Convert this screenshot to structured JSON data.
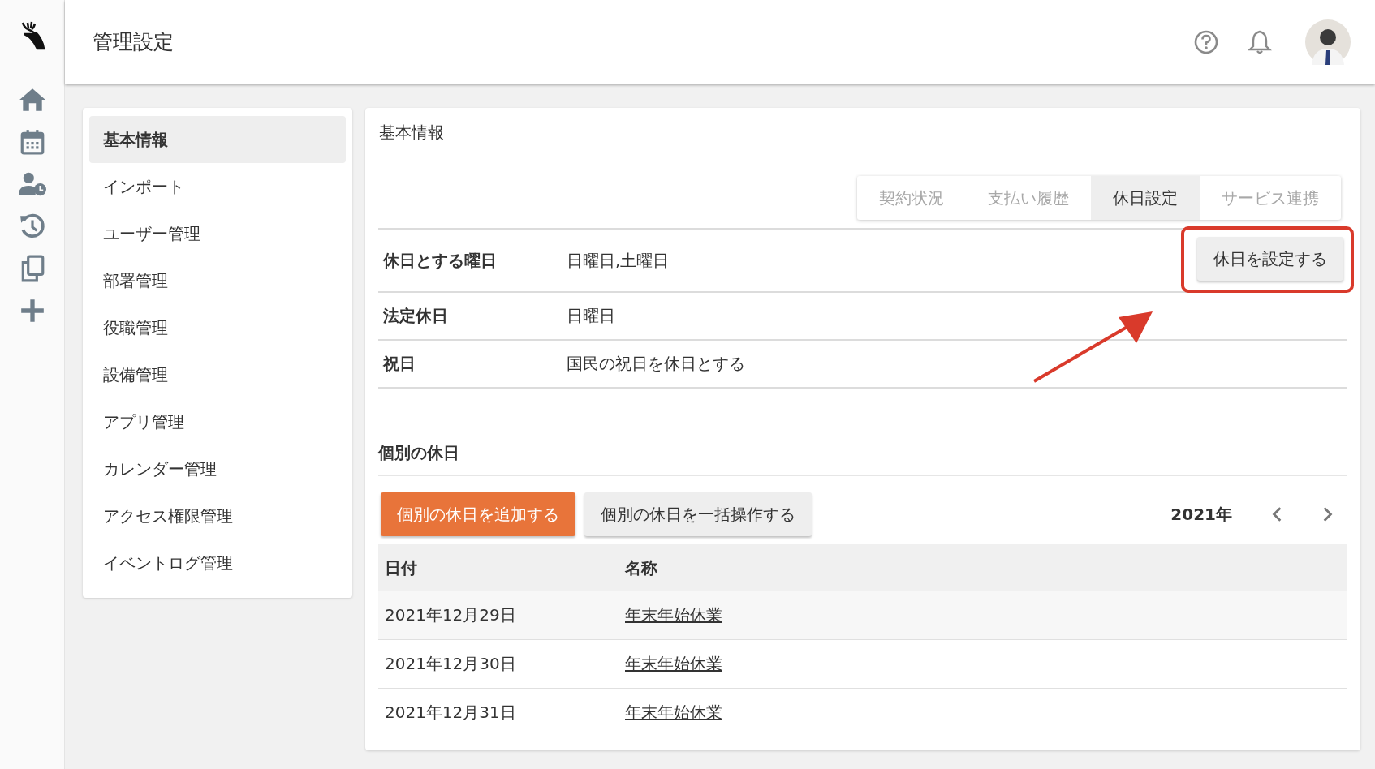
{
  "header": {
    "title": "管理設定"
  },
  "menu": [
    {
      "label": "基本情報",
      "selected": true
    },
    {
      "label": "インポート",
      "selected": false
    },
    {
      "label": "ユーザー管理",
      "selected": false
    },
    {
      "label": "部署管理",
      "selected": false
    },
    {
      "label": "役職管理",
      "selected": false
    },
    {
      "label": "設備管理",
      "selected": false
    },
    {
      "label": "アプリ管理",
      "selected": false
    },
    {
      "label": "カレンダー管理",
      "selected": false
    },
    {
      "label": "アクセス権限管理",
      "selected": false
    },
    {
      "label": "イベントログ管理",
      "selected": false
    }
  ],
  "card": {
    "title": "基本情報",
    "tabs": [
      {
        "label": "契約状況",
        "selected": false
      },
      {
        "label": "支払い履歴",
        "selected": false
      },
      {
        "label": "休日設定",
        "selected": true
      },
      {
        "label": "サービス連携",
        "selected": false
      }
    ],
    "settings": [
      {
        "label": "休日とする曜日",
        "value": "日曜日,土曜日"
      },
      {
        "label": "法定休日",
        "value": "日曜日"
      },
      {
        "label": "祝日",
        "value": "国民の祝日を休日とする"
      }
    ],
    "set_button": "休日を設定する",
    "section_title": "個別の休日",
    "add_button": "個別の休日を追加する",
    "bulk_button": "個別の休日を一括操作する",
    "year": "2021年",
    "table": {
      "columns": [
        "日付",
        "名称"
      ],
      "rows": [
        {
          "date": "2021年12月29日",
          "name": "年末年始休業"
        },
        {
          "date": "2021年12月30日",
          "name": "年末年始休業"
        },
        {
          "date": "2021年12月31日",
          "name": "年末年始休業"
        }
      ]
    }
  }
}
